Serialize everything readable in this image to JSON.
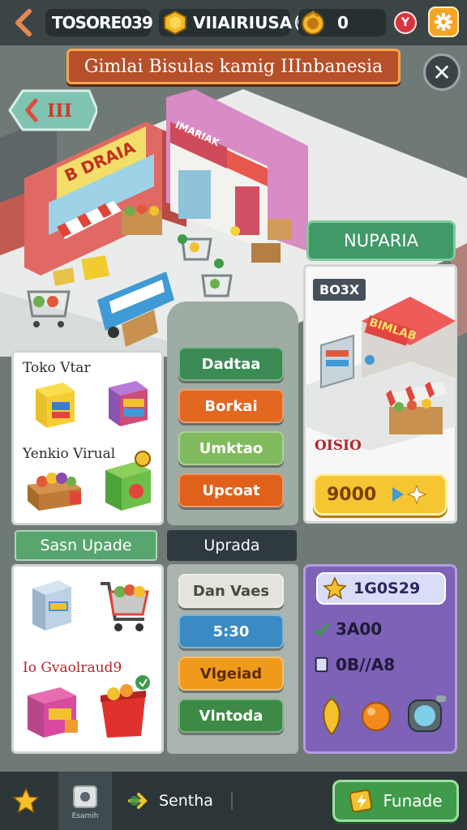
{
  "hud": {
    "store_code": "TOSORE039",
    "vault_label": "VIIAIRIUSA",
    "vault_badge": "0",
    "coins": "0",
    "notif_badge": "Y"
  },
  "title": "Gimlai Bisulas kamig IIInbanesia",
  "close_label": "✕",
  "level_tag": "III",
  "scene_signs": {
    "main_shop": "B DRAIA",
    "side_shop": "IMARIAK"
  },
  "toko_card": {
    "label1": "Toko Vtar",
    "label2": "Yenkio Virual"
  },
  "actions": [
    {
      "label": "Dadtaa",
      "color": "#3c8a54"
    },
    {
      "label": "Borkai",
      "color": "#e2671f"
    },
    {
      "label": "Umktao",
      "color": "#7fba5c"
    },
    {
      "label": "Upcoat",
      "color": "#e1611b"
    }
  ],
  "nuparia_button": "NUPARIA",
  "shop_card": {
    "tag": "BO3X",
    "shop_sign": "BIMLAB",
    "label": "OISIO",
    "price": "9000"
  },
  "section_green": "Sasn Upade",
  "section_dark": "Uprada",
  "upgrade_card": {
    "label": "Io Gvaolraud9"
  },
  "upgrade_actions": [
    {
      "label": "Dan Vaes",
      "color": "#e4e4dc",
      "text": "#4a4a40"
    },
    {
      "label": "5:30",
      "color": "#3a8bc4",
      "text": "#ffffff"
    },
    {
      "label": "Vlgeiad",
      "color": "#f09a1c",
      "text": "#5a2a00"
    },
    {
      "label": "Vlntoda",
      "color": "#3c8a45",
      "text": "#ffffff"
    }
  ],
  "stats": {
    "total": "1G0S29",
    "line1": "3A00",
    "line2": "0B//A8"
  },
  "bottom": {
    "tab_label": "Esamih",
    "sentha": "Sentha",
    "fund_button": "Funade"
  }
}
